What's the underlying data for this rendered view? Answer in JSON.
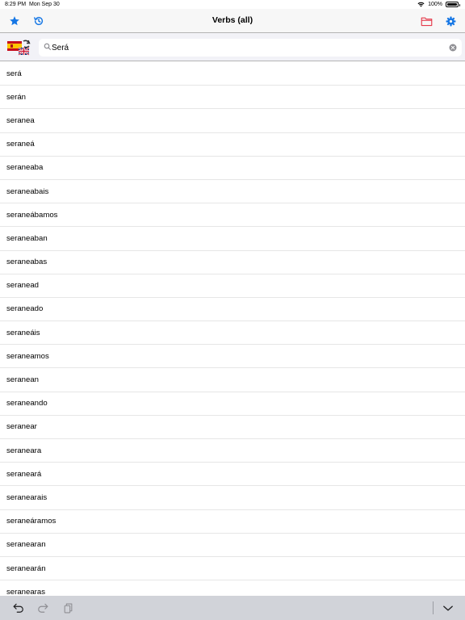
{
  "status_bar": {
    "time": "8:29 PM",
    "date": "Mon Sep 30",
    "battery": "100%",
    "battery_level": 1.0,
    "wifi_icon": "wifi-icon"
  },
  "nav_bar": {
    "title": "Verbs (all)",
    "left_icons": [
      "star-icon",
      "history-icon"
    ],
    "right_icons": [
      "folder-icon",
      "gear-icon"
    ]
  },
  "search": {
    "value": "Será",
    "language_icon": "spanish-english-flags-icon"
  },
  "words": [
    "será",
    "serán",
    "seranea",
    "seraneá",
    "seraneaba",
    "seraneabais",
    "seraneábamos",
    "seraneaban",
    "seraneabas",
    "seranead",
    "seraneado",
    "seraneáis",
    "seraneamos",
    "seranean",
    "seraneando",
    "seranear",
    "seraneara",
    "seraneará",
    "seranearais",
    "seraneáramos",
    "seranearan",
    "seranearán",
    "seranearas"
  ],
  "toolbar_icons": [
    "undo-icon",
    "redo-icon",
    "paste-icon",
    "dismiss-keyboard-icon"
  ],
  "colors": {
    "accent": "#1677e5",
    "folder": "#e5394a",
    "nav_background": "#f7f7f7",
    "toolbar_background": "#d1d3d9"
  }
}
